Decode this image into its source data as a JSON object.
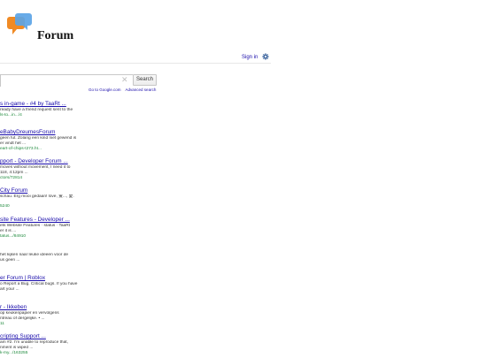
{
  "header": {
    "brand": "Forum",
    "signin": "Sign in"
  },
  "search": {
    "value": "",
    "button": "Search",
    "sublinks": [
      "Go to Google.com",
      "Advanced search"
    ]
  },
  "results": [
    {
      "title": "s in-game - #4 by TaaRt ...",
      "lines": [
        "ready have a friend request sent to the"
      ],
      "url": "ls-to...in.../4"
    },
    {
      "title": "eBabyDreumesForum",
      "lines": [
        "geen fut. Zolang een kind niet gewend is",
        "er vindt het ..."
      ],
      "url": "eart-of-chips-t273.ht..."
    },
    {
      "title": "pport - Developer Forum ...",
      "lines": [
        "moves without movement, I need it to",
        "118, 4:12pm ..."
      ],
      "url": "ctors/72814"
    },
    {
      "title": "City Forum",
      "lines": [
        "schau. Erg mooi gedaan! love, 爱..., 愛."
      ],
      "url": "5240"
    },
    {
      "title": "site Features - Developer ...",
      "lines": [
        "ets Website Features · status · TaaRt",
        "er it is ..."
      ],
      "url": "tatus.../84910"
    },
    {
      "title": "",
      "lines": [
        "het kijken naar leuke ideeen voor de",
        "us geen ..."
      ],
      "url": ""
    },
    {
      "title": "er Forum | Roblox",
      "lines": [
        "o Report a Bug. Critical bugs. If you have",
        "art your ..."
      ],
      "url": ""
    },
    {
      "title": "r - Ikkeben",
      "lines": [
        "op keukenpapier en vervolgens",
        "ntreau of dergelijke. • ..."
      ],
      "url": "11"
    },
    {
      "title": "cripting Support ...",
      "lines": [
        "am #2. I'm unable to reproduce that,",
        "nment is wiped ..."
      ],
      "url": "k-my.../163255"
    }
  ],
  "colors": {
    "accent_orange": "#f08a24",
    "accent_blue": "#4a90e2",
    "link": "#1a0dab",
    "url_green": "#1e8a3c"
  },
  "icons": {
    "logo": "speech-bubbles-icon",
    "settings": "gear-icon",
    "clear": "close-icon"
  }
}
